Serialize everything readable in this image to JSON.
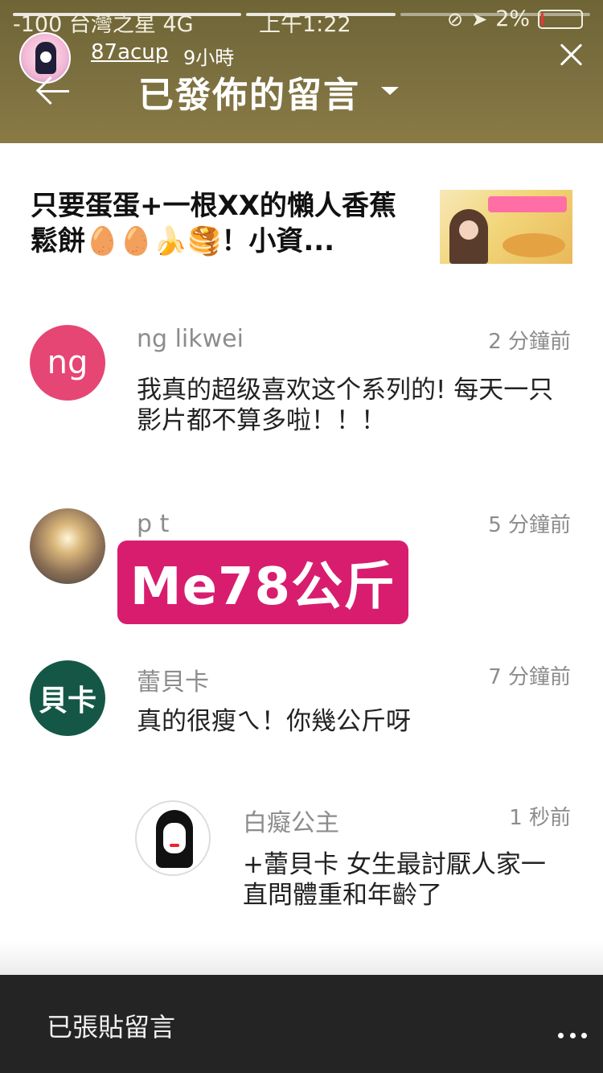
{
  "status_bar": {
    "carrier": "-100 台灣之星  4G",
    "time": "上午1:22",
    "battery": "2%",
    "icons": [
      "lock-rotation-icon",
      "location-arrow-icon",
      "battery-icon"
    ]
  },
  "story": {
    "username": "87acup",
    "posted": "9小時"
  },
  "header": {
    "title": "已發佈的留言"
  },
  "video": {
    "title": "只要蛋蛋+一根XX的懶人香蕉鬆餅🥚🥚🍌🥞！小資..."
  },
  "sticker": {
    "text": "Me78公斤"
  },
  "comments": [
    {
      "initials": "ng",
      "name": "ng likwei",
      "time": "2 分鐘前",
      "text": "我真的超级喜欢这个系列的! 每天一只影片都不算多啦！！！",
      "color": "#e54673"
    },
    {
      "initials": "",
      "name": "p t",
      "time": "5 分鐘前",
      "text": ""
    },
    {
      "initials": "貝卡",
      "name": "蕾貝卡",
      "time": "7 分鐘前",
      "text": "真的很瘦ㄟ！你幾公斤呀",
      "color": "#155746"
    }
  ],
  "reply": {
    "name": "白癡公主",
    "time": "1 秒前",
    "text": "+蕾貝卡 女生最討厭人家一直問體重和年齡了"
  },
  "footer": {
    "label": "已張貼留言",
    "more_icon": "more-dots-icon"
  },
  "colors": {
    "header_bg": "#7c7040",
    "sticker_bg": "#d81d6f",
    "bottom_bar": "#242424"
  }
}
